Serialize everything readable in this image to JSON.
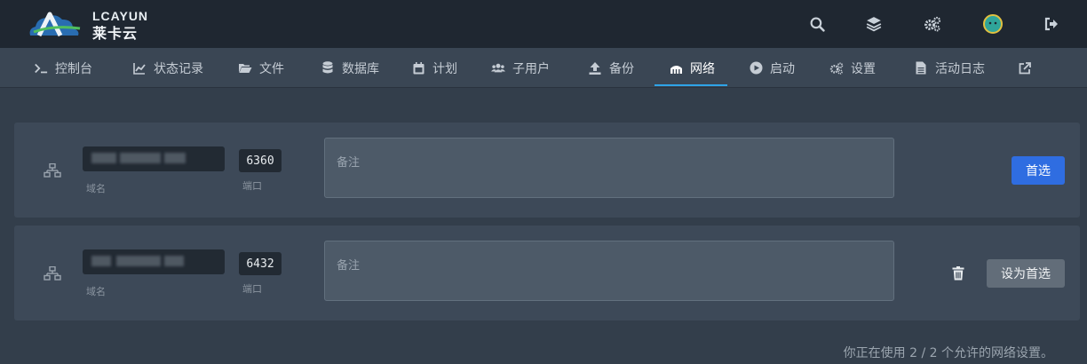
{
  "app": {
    "logo_text": "LCAYUN",
    "logo_sub": "莱卡云"
  },
  "topbar": {
    "icons": [
      "search-icon",
      "layers-icon",
      "cogs-icon",
      "avatar",
      "sign-out-icon"
    ]
  },
  "nav": {
    "items": [
      {
        "label": "控制台",
        "icon": "terminal-icon"
      },
      {
        "label": "状态记录",
        "icon": "chart-line-icon"
      },
      {
        "label": "文件",
        "icon": "folder-open-icon"
      },
      {
        "label": "数据库",
        "icon": "database-icon"
      },
      {
        "label": "计划",
        "icon": "calendar-icon"
      },
      {
        "label": "子用户",
        "icon": "users-icon"
      },
      {
        "label": "备份",
        "icon": "upload-icon"
      },
      {
        "label": "网络",
        "icon": "network-wired-icon",
        "active": true
      },
      {
        "label": "启动",
        "icon": "play-circle-icon"
      },
      {
        "label": "设置",
        "icon": "cogs-icon"
      },
      {
        "label": "活动日志",
        "icon": "file-alt-icon"
      },
      {
        "label": "",
        "icon": "external-link-icon"
      }
    ]
  },
  "allocations": [
    {
      "domain_label": "域名",
      "port": "6360",
      "port_label": "端口",
      "notes_placeholder": "备注",
      "primary_button": "首选"
    },
    {
      "domain_label": "域名",
      "port": "6432",
      "port_label": "端口",
      "notes_placeholder": "备注",
      "set_primary_button": "设为首选"
    }
  ],
  "footer": {
    "usage_text": "你正在使用 2 / 2 个允许的网络设置。"
  },
  "colors": {
    "accent": "#2fa4e7",
    "primary_button": "#2f6de1"
  }
}
